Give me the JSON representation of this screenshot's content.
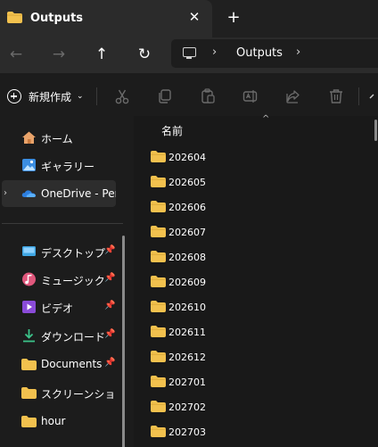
{
  "tab": {
    "title": "Outputs",
    "close_glyph": "✕",
    "new_tab_glyph": "+"
  },
  "nav": {
    "back_glyph": "←",
    "forward_glyph": "→",
    "up_glyph": "↑",
    "refresh_glyph": "↻",
    "breadcrumb_sep": "›",
    "breadcrumb": [
      "Outputs"
    ]
  },
  "commandbar": {
    "new_label": "新規作成",
    "new_caret": "⌄",
    "tools": [
      "cut-icon",
      "copy-icon",
      "paste-icon",
      "rename-icon",
      "share-icon",
      "delete-icon"
    ]
  },
  "sidebar": {
    "expander_glyph": "›",
    "pin_glyph": "📌",
    "items": [
      {
        "label": "ホーム",
        "icon": "home-icon"
      },
      {
        "label": "ギャラリー",
        "icon": "gallery-icon"
      },
      {
        "label": "OneDrive - Perso",
        "icon": "onedrive-icon"
      },
      {
        "label": "デスクトップ",
        "icon": "desktop-icon"
      },
      {
        "label": "ミュージック",
        "icon": "music-icon"
      },
      {
        "label": "ビデオ",
        "icon": "video-icon"
      },
      {
        "label": "ダウンロード",
        "icon": "download-icon"
      },
      {
        "label": "Documents",
        "icon": "folder-icon"
      },
      {
        "label": "スクリーンショット",
        "icon": "folder-icon"
      },
      {
        "label": "hour",
        "icon": "folder-icon"
      }
    ]
  },
  "main": {
    "column_name": "名前",
    "sort_glyph": "^",
    "folders": [
      "202604",
      "202605",
      "202606",
      "202607",
      "202608",
      "202609",
      "202610",
      "202611",
      "202612",
      "202701",
      "202702",
      "202703"
    ]
  },
  "colors": {
    "folder": "#f2c14e",
    "accent_blue": "#3b8de0",
    "selection": "#2d2d2d"
  }
}
